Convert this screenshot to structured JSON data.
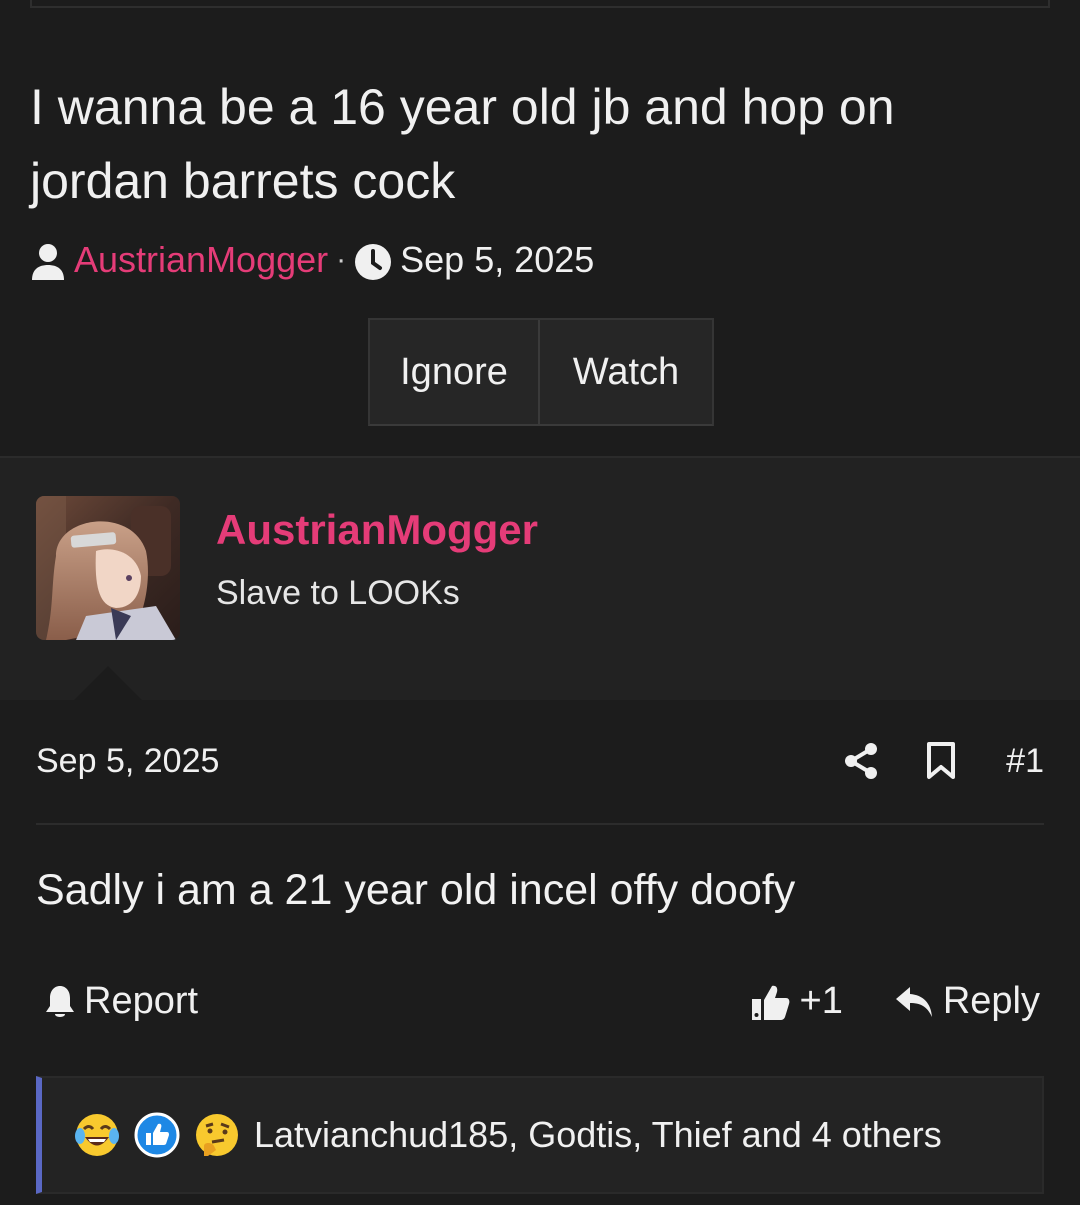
{
  "thread": {
    "title": "I wanna be a 16 year old jb and hop on jordan barrets cock",
    "author": "AustrianMogger",
    "separator": "·",
    "date": "Sep 5, 2025"
  },
  "thread_buttons": {
    "ignore_label": "Ignore",
    "watch_label": "Watch"
  },
  "post": {
    "username": "AustrianMogger",
    "user_title": "Slave to LOOKs",
    "date": "Sep 5, 2025",
    "number": "#1",
    "body": "Sadly i am a 21 year old incel offy doofy",
    "report_label": "Report",
    "like_count": "+1",
    "reply_label": "Reply"
  },
  "reactions": {
    "text": "Latvianchud185, Godtis, Thief and 4 others",
    "emojis": [
      "crying-laughing-emoji",
      "thumbs-up-emoji",
      "thinking-emoji"
    ]
  },
  "colors": {
    "background": "#1c1c1c",
    "accent_username": "#e53c78",
    "reaction_border": "#5a68c4"
  }
}
